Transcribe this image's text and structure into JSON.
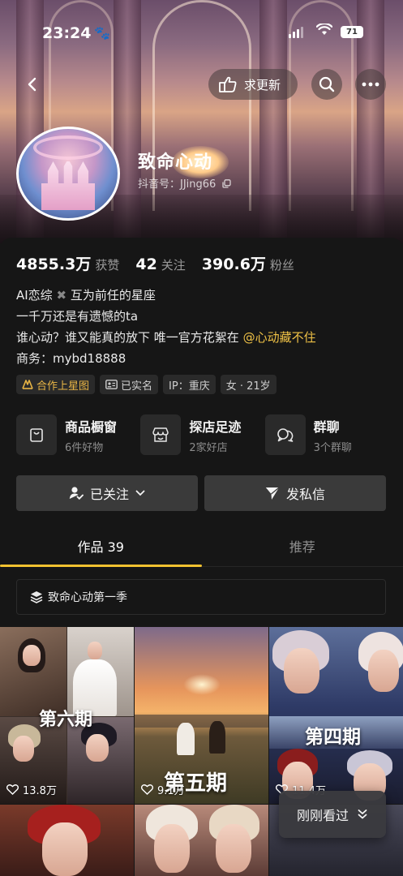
{
  "status_bar": {
    "time": "23:24",
    "battery": "71"
  },
  "nav": {
    "update_request_label": "求更新"
  },
  "profile": {
    "name": "致命心动",
    "douyin_id": "抖音号：JJing66"
  },
  "stats": [
    {
      "value": "4855.3万",
      "label": "获赞"
    },
    {
      "value": "42",
      "label": "关注"
    },
    {
      "value": "390.6万",
      "label": "粉丝"
    }
  ],
  "bio": {
    "line1_a": "AI恋综",
    "line1_b": "互为前任的星座",
    "line2": "一千万还是有遗憾的ta",
    "line3_a": "谁心动？谁又能真的放下 唯一官方花絮在",
    "line3_mention": "@心动藏不住",
    "line4": "商务：mybd18888"
  },
  "tags": [
    {
      "label": "合作上星图",
      "icon": "star-map-icon"
    },
    {
      "label": "已实名",
      "icon": "id-card-icon"
    },
    {
      "label": "IP：重庆"
    },
    {
      "label": "女 · 21岁"
    }
  ],
  "services": [
    {
      "title": "商品橱窗",
      "subtitle": "6件好物",
      "icon": "shopping-bag-icon"
    },
    {
      "title": "探店足迹",
      "subtitle": "2家好店",
      "icon": "store-icon"
    },
    {
      "title": "群聊",
      "subtitle": "3个群聊",
      "icon": "chat-bubbles-icon"
    }
  ],
  "actions": {
    "following_label": "已关注",
    "message_label": "发私信"
  },
  "tabs": [
    {
      "label": "作品 39",
      "active": true
    },
    {
      "label": "推荐",
      "active": false
    }
  ],
  "collection": {
    "label": "致命心动第一季"
  },
  "videos": [
    {
      "episode_label": "第六期",
      "likes": "13.8万"
    },
    {
      "episode_label": "第五期",
      "likes": "9.1万"
    },
    {
      "episode_label": "第四期",
      "likes": "11.4万"
    }
  ],
  "recent_button": {
    "label": "刚刚看过"
  },
  "colors": {
    "accent": "#f2c230",
    "mention": "#f0c246",
    "background": "#161616"
  }
}
